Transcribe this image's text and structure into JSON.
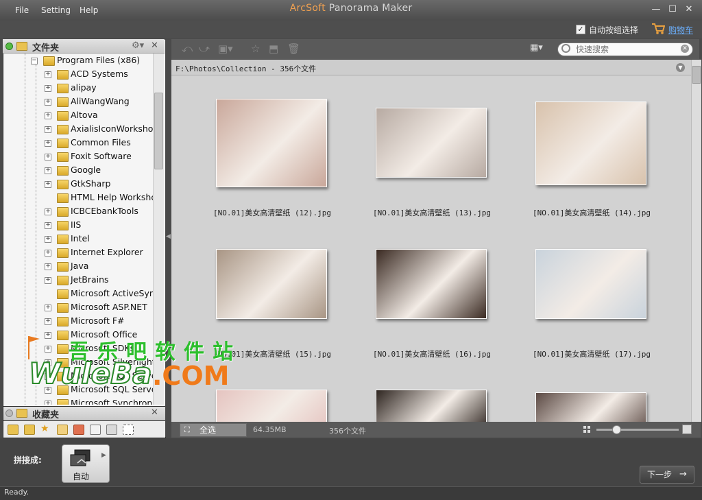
{
  "window": {
    "title_a": "ArcSoft",
    "title_b": " Panorama Maker",
    "min_icon": "minimize-icon",
    "max_icon": "maximize-icon",
    "close_icon": "close-icon"
  },
  "menu": {
    "file": "File",
    "setting": "Setting",
    "help": "Help"
  },
  "topbar": {
    "auto_group_label": "自动按组选择",
    "auto_group_checked": true,
    "cart_label": "购物车"
  },
  "folders": {
    "title": "文件夹",
    "root": "Program Files (x86)",
    "items": [
      {
        "label": "ACD Systems",
        "expandable": true
      },
      {
        "label": "alipay",
        "expandable": true
      },
      {
        "label": "AliWangWang",
        "expandable": true
      },
      {
        "label": "Altova",
        "expandable": true
      },
      {
        "label": "AxialisIconWorkshop",
        "expandable": true
      },
      {
        "label": "Common Files",
        "expandable": true
      },
      {
        "label": "Foxit Software",
        "expandable": true
      },
      {
        "label": "Google",
        "expandable": true
      },
      {
        "label": "GtkSharp",
        "expandable": true
      },
      {
        "label": "HTML Help Workshop",
        "expandable": false
      },
      {
        "label": "ICBCEbankTools",
        "expandable": true
      },
      {
        "label": "IIS",
        "expandable": true
      },
      {
        "label": "Intel",
        "expandable": true
      },
      {
        "label": "Internet Explorer",
        "expandable": true
      },
      {
        "label": "Java",
        "expandable": true
      },
      {
        "label": "JetBrains",
        "expandable": true
      },
      {
        "label": "Microsoft ActiveSync",
        "expandable": false
      },
      {
        "label": "Microsoft ASP.NET",
        "expandable": true
      },
      {
        "label": "Microsoft F#",
        "expandable": true
      },
      {
        "label": "Microsoft Office",
        "expandable": true
      },
      {
        "label": "Microsoft SDKs",
        "expandable": true
      },
      {
        "label": "Microsoft Silverlight",
        "expandable": true
      },
      {
        "label": "Microsoft SQL Server",
        "expandable": true
      },
      {
        "label": "Microsoft SQL Server",
        "expandable": true
      },
      {
        "label": "Microsoft Synchronization",
        "expandable": true
      }
    ]
  },
  "favorites": {
    "title": "收藏夹"
  },
  "toolbar": {
    "search_placeholder": "快速搜索"
  },
  "path": {
    "text": "F:\\Photos\\Collection - 356个文件"
  },
  "photos": [
    {
      "caption": "[NO.01]美女高清壁纸 (12).jpg",
      "tone": "#c9a79a"
    },
    {
      "caption": "[NO.01]美女高清壁纸 (13).jpg",
      "tone": "#b7aaa2"
    },
    {
      "caption": "[NO.01]美女高清壁纸 (14).jpg",
      "tone": "#d8c2ac"
    },
    {
      "caption": "[NO.01]美女高清壁纸 (15).jpg",
      "tone": "#a89584"
    },
    {
      "caption": "[NO.01]美女高清壁纸 (16).jpg",
      "tone": "#3a2a22"
    },
    {
      "caption": "[NO.01]美女高清壁纸 (17).jpg",
      "tone": "#c9d3dc"
    },
    {
      "caption": "",
      "tone": "#e5c4c0"
    },
    {
      "caption": "",
      "tone": "#2e2520"
    },
    {
      "caption": "",
      "tone": "#5c4a44"
    }
  ],
  "status_strip": {
    "select_all": "全选",
    "total_size": "64.35MB",
    "file_count": "356个文件"
  },
  "bottom": {
    "stitch_label": "拼接成:",
    "mode": "自动",
    "next": "下一步"
  },
  "statusbar": {
    "text": "Ready."
  },
  "watermark": {
    "cn": "吾乐吧软件站",
    "logo_text": "WuleBa",
    "logo_com": ".COM"
  }
}
